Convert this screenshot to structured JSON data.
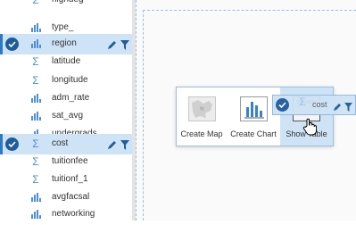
{
  "sidebar": {
    "fields": [
      {
        "name": "highdeg",
        "type": "sigma",
        "selected": false
      },
      {
        "name": "type_",
        "type": "bars",
        "selected": false
      },
      {
        "name": "region",
        "type": "bars",
        "selected": true
      },
      {
        "name": "latitude",
        "type": "sigma",
        "selected": false
      },
      {
        "name": "longitude",
        "type": "sigma",
        "selected": false
      },
      {
        "name": "adm_rate",
        "type": "bars",
        "selected": false
      },
      {
        "name": "sat_avg",
        "type": "bars",
        "selected": false
      },
      {
        "name": "undergrads",
        "type": "bars",
        "selected": false
      },
      {
        "name": "cost",
        "type": "sigma",
        "selected": true
      },
      {
        "name": "tuitionfee",
        "type": "sigma",
        "selected": false
      },
      {
        "name": "tuitionf_1",
        "type": "sigma",
        "selected": false
      },
      {
        "name": "avgfacsal",
        "type": "bars",
        "selected": false
      },
      {
        "name": "networking",
        "type": "bars",
        "selected": false
      }
    ]
  },
  "drop_menu": {
    "options": [
      {
        "label": "Create Map",
        "icon": "map-thumbnail-icon"
      },
      {
        "label": "Create Chart",
        "icon": "chart-thumbnail-icon"
      },
      {
        "label": "Show Table",
        "icon": "table-thumbnail-icon"
      }
    ]
  },
  "drag_chip": {
    "label": "cost"
  },
  "colors": {
    "accent": "#2b7bc4",
    "selected_bg": "#cfe3f6",
    "icon_blue": "#4b8fd6",
    "check_bg": "#1f5c99"
  }
}
